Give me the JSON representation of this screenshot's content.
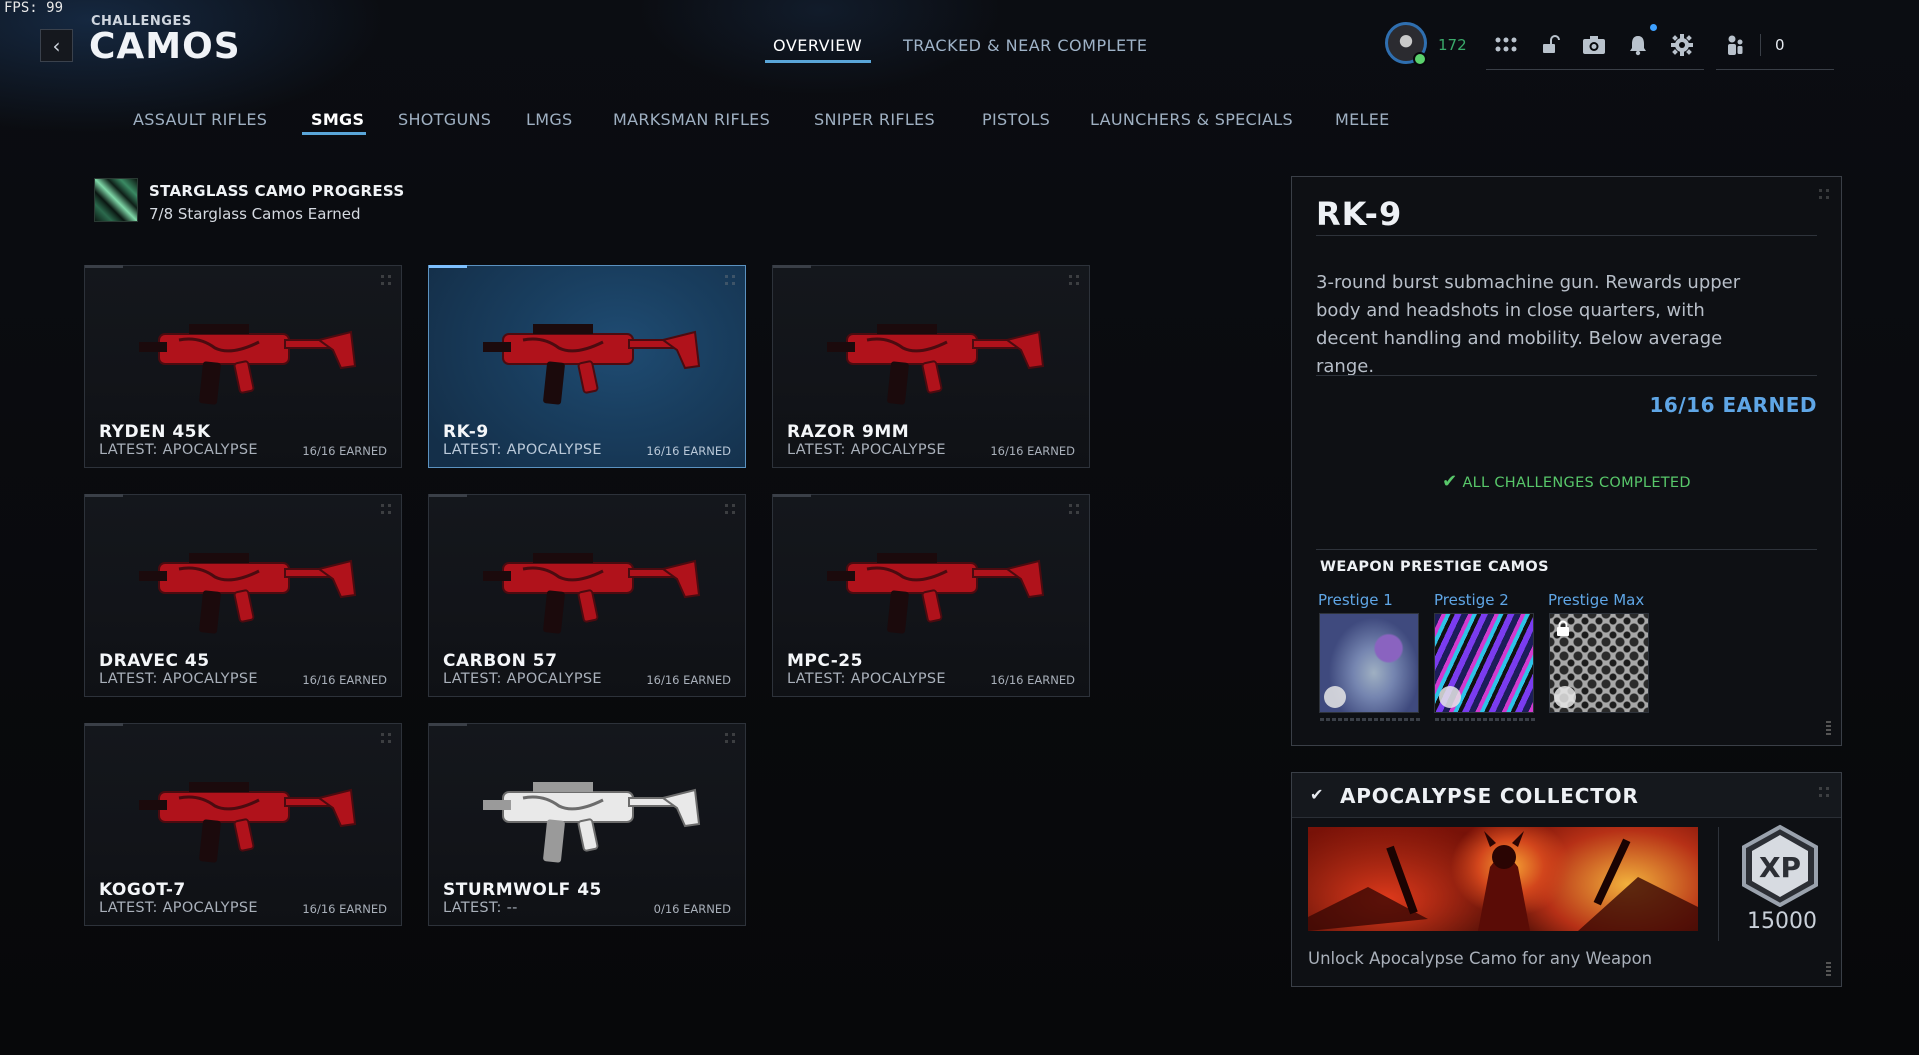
{
  "fps": {
    "label": "FPS:",
    "value": "99"
  },
  "header": {
    "breadcrumb": "CHALLENGES",
    "title": "CAMOS",
    "tabs": [
      {
        "label": "OVERVIEW",
        "active": true
      },
      {
        "label": "TRACKED & NEAR COMPLETE",
        "active": false
      }
    ],
    "player_level": "172",
    "currency": "0"
  },
  "categories": [
    {
      "label": "ASSAULT RIFLES",
      "active": false
    },
    {
      "label": "SMGS",
      "active": true
    },
    {
      "label": "SHOTGUNS",
      "active": false
    },
    {
      "label": "LMGS",
      "active": false
    },
    {
      "label": "MARKSMAN RIFLES",
      "active": false
    },
    {
      "label": "SNIPER RIFLES",
      "active": false
    },
    {
      "label": "PISTOLS",
      "active": false
    },
    {
      "label": "LAUNCHERS & SPECIALS",
      "active": false
    },
    {
      "label": "MELEE",
      "active": false
    }
  ],
  "starglass": {
    "title": "STARGLASS CAMO PROGRESS",
    "subtitle": "7/8 Starglass Camos Earned"
  },
  "weapons": [
    {
      "name": "RYDEN 45K",
      "latest": "LATEST: APOCALYPSE",
      "earned": "16/16 EARNED",
      "camo": "red",
      "selected": false
    },
    {
      "name": "RK-9",
      "latest": "LATEST: APOCALYPSE",
      "earned": "16/16 EARNED",
      "camo": "red",
      "selected": true
    },
    {
      "name": "RAZOR 9MM",
      "latest": "LATEST: APOCALYPSE",
      "earned": "16/16 EARNED",
      "camo": "red",
      "selected": false
    },
    {
      "name": "DRAVEC 45",
      "latest": "LATEST: APOCALYPSE",
      "earned": "16/16 EARNED",
      "camo": "red",
      "selected": false
    },
    {
      "name": "CARBON 57",
      "latest": "LATEST: APOCALYPSE",
      "earned": "16/16 EARNED",
      "camo": "red",
      "selected": false
    },
    {
      "name": "MPC-25",
      "latest": "LATEST: APOCALYPSE",
      "earned": "16/16 EARNED",
      "camo": "red",
      "selected": false
    },
    {
      "name": "KOGOT-7",
      "latest": "LATEST: APOCALYPSE",
      "earned": "16/16 EARNED",
      "camo": "red",
      "selected": false
    },
    {
      "name": "STURMWOLF 45",
      "latest": "LATEST: --",
      "earned": "0/16 EARNED",
      "camo": "white",
      "selected": false
    }
  ],
  "detail": {
    "title": "RK-9",
    "description": "3-round burst submachine gun. Rewards upper body and headshots in close quarters, with decent handling and mobility. Below average range.",
    "earned": "16/16 EARNED",
    "status": "ALL CHALLENGES COMPLETED",
    "prestige_heading": "WEAPON PRESTIGE CAMOS",
    "prestige": [
      {
        "label": "Prestige 1",
        "locked": false
      },
      {
        "label": "Prestige 2",
        "locked": false
      },
      {
        "label": "Prestige Max",
        "locked": true
      }
    ]
  },
  "collector": {
    "title": "APOCALYPSE COLLECTOR",
    "xp_badge": "XP",
    "xp": "15000",
    "description": "Unlock Apocalypse Camo for any Weapon"
  },
  "colors": {
    "accent": "#5aa6d9",
    "earned_blue": "#5fa6e6",
    "complete_green": "#58c76a",
    "camo_red": "#b0121b"
  }
}
